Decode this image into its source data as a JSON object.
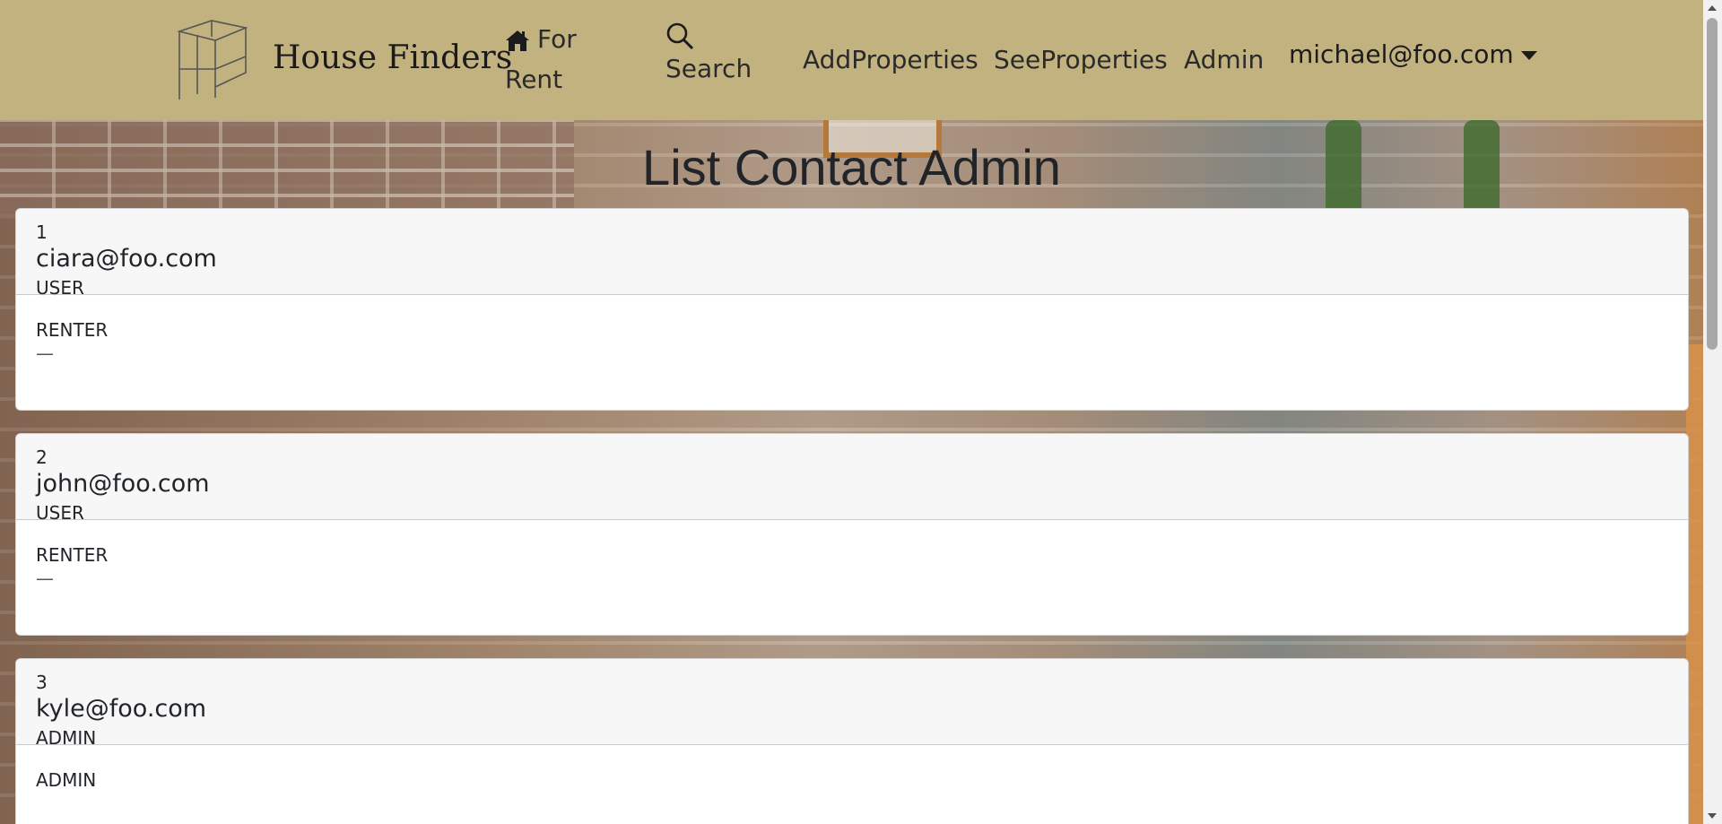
{
  "brand": {
    "name": "House Finders",
    "logo_icon": "house-frame-logo-icon"
  },
  "nav": {
    "for_rent": "For Rent",
    "search": "Search",
    "add_properties": "AddProperties",
    "see_properties": "SeeProperties",
    "admin": "Admin",
    "user_email": "michael@foo.com"
  },
  "page": {
    "title": "List Contact Admin"
  },
  "contacts": [
    {
      "id": "1",
      "email": "ciara@foo.com",
      "role": "USER",
      "type": "RENTER",
      "note": "—"
    },
    {
      "id": "2",
      "email": "john@foo.com",
      "role": "USER",
      "type": "RENTER",
      "note": "—"
    },
    {
      "id": "3",
      "email": "kyle@foo.com",
      "role": "ADMIN",
      "type": "ADMIN",
      "note": ""
    }
  ],
  "colors": {
    "navbar": "#c2b280",
    "card_header": "#f7f7f7"
  }
}
